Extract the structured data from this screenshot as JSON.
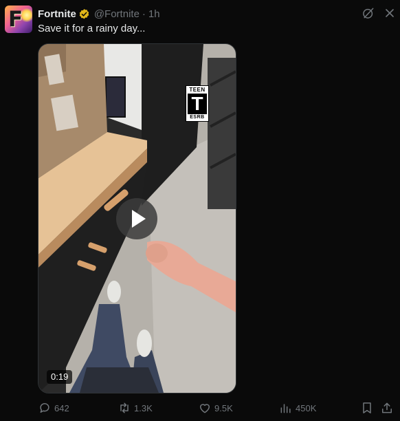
{
  "author": {
    "name": "Fortnite",
    "handle": "@Fortnite",
    "separator": "·",
    "time": "1h",
    "avatar_letter": "F",
    "verified_color": "#e2b719"
  },
  "tweet": {
    "text": "Save it for a rainy day..."
  },
  "media": {
    "type": "video",
    "rating_top": "TEEN",
    "rating_letter": "T",
    "rating_bottom": "ESRB",
    "duration": "0:19"
  },
  "actions": {
    "replies": "642",
    "reposts": "1.3K",
    "likes": "9.5K",
    "views": "450K"
  },
  "icons": {
    "header": [
      "grok-icon",
      "more-icon"
    ],
    "actions": [
      "reply-icon",
      "repost-icon",
      "like-icon",
      "views-icon",
      "bookmark-icon",
      "share-icon"
    ]
  },
  "colors": {
    "background": "#0a0a0a",
    "text": "#e7e9ea",
    "secondary": "#71767b"
  }
}
